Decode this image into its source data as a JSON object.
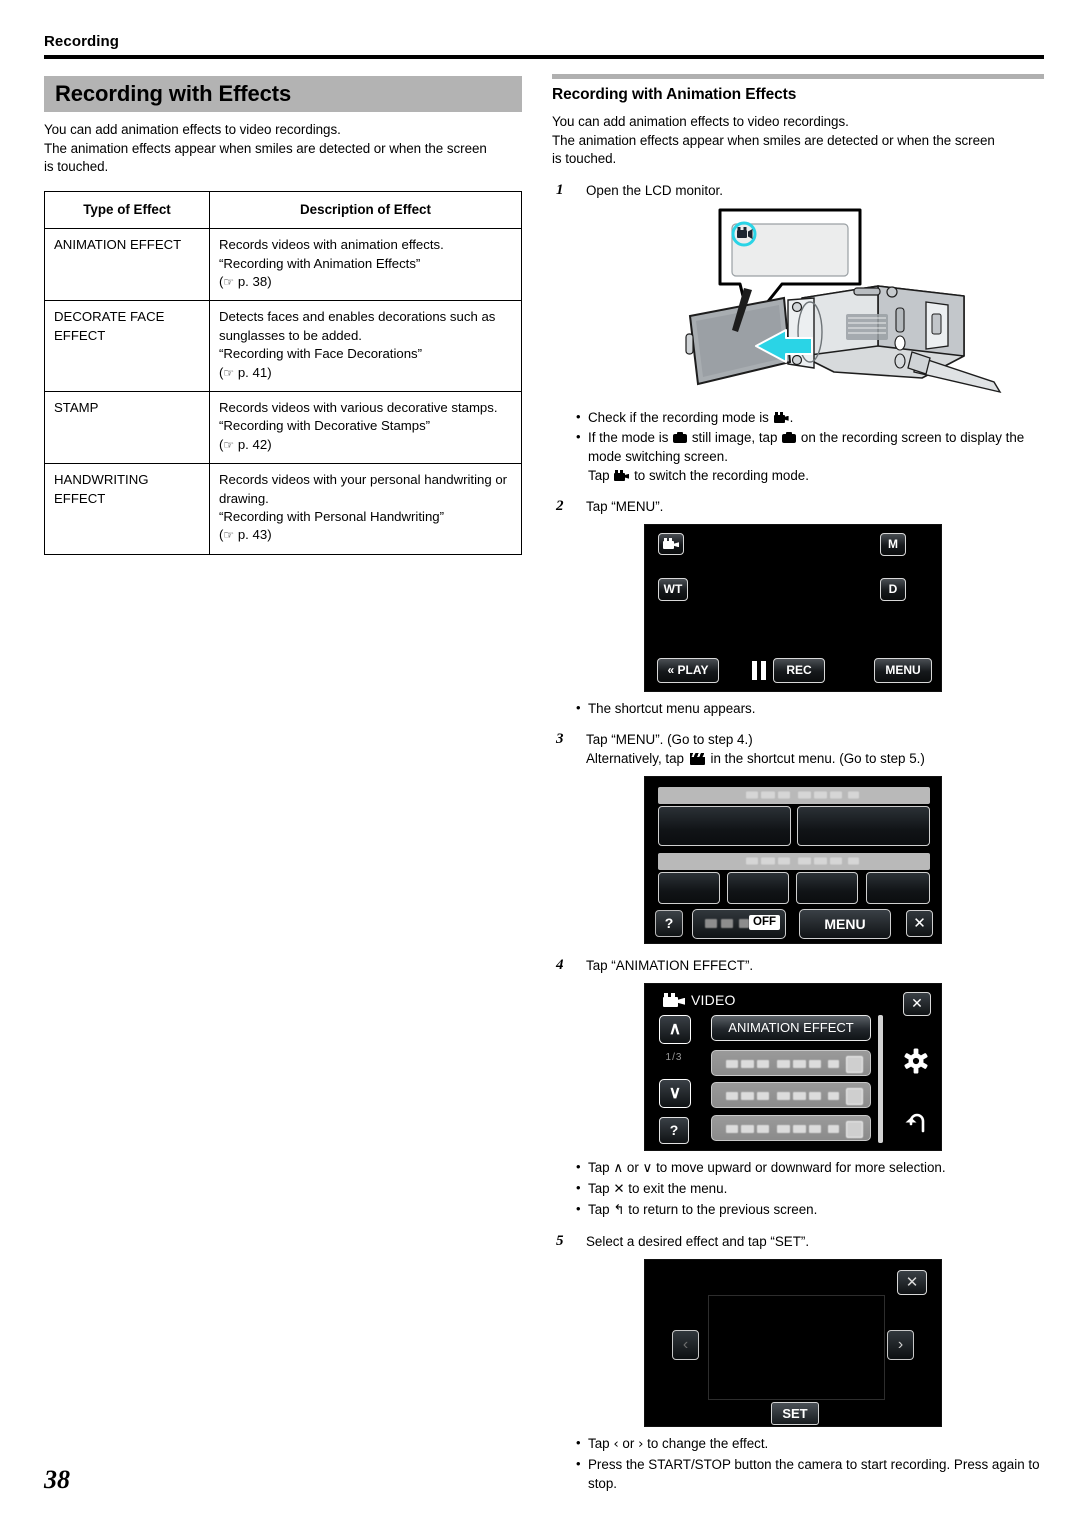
{
  "header": {
    "running_head": "Recording"
  },
  "left_column": {
    "title": "Recording with Effects",
    "intro_line1": "You can add animation effects to video recordings.",
    "intro_line2": "The animation effects appear when smiles are detected or when the screen",
    "intro_line3": "is touched.",
    "table": {
      "headers": [
        "Type of Effect",
        "Description of Effect"
      ],
      "rows": [
        {
          "type": "ANIMATION EFFECT",
          "desc_line1": "Records videos with animation effects.",
          "desc_line2": "“Recording with Animation Effects”",
          "page_ref": "p. 38"
        },
        {
          "type": "DECORATE FACE EFFECT",
          "desc_line1": "Detects faces and enables decorations such as sunglasses to be added.",
          "desc_line2": "“Recording with Face Decorations”",
          "page_ref": "p. 41"
        },
        {
          "type": "STAMP",
          "desc_line1": "Records videos with various decorative stamps.",
          "desc_line2": "“Recording with Decorative Stamps”",
          "page_ref": "p. 42"
        },
        {
          "type": "HANDWRITING EFFECT",
          "desc_line1": "Records videos with your personal handwriting or drawing.",
          "desc_line2": "“Recording with Personal Handwriting”",
          "page_ref": "p. 43"
        }
      ]
    }
  },
  "right_column": {
    "section_title": "Recording with Animation Effects",
    "intro_line1": "You can add animation effects to video recordings.",
    "intro_line2": "The animation effects appear when smiles are detected or when the screen",
    "intro_line3": "is touched.",
    "steps": [
      {
        "num": "1",
        "text": "Open the LCD monitor."
      },
      {
        "num": "2",
        "text": "Tap “MENU”."
      },
      {
        "num": "3",
        "line1": "Tap “MENU”. (Go to step 4.)",
        "line2_a": "Alternatively, tap",
        "line2_b": "in the shortcut menu. (Go to step 5.)"
      },
      {
        "num": "4",
        "text": "Tap “ANIMATION EFFECT”."
      },
      {
        "num": "5",
        "text": "Select a desired effect and tap “SET”."
      }
    ],
    "bullets_step1": [
      {
        "a": "Check if the recording mode is",
        "b": "."
      },
      {
        "a": "If the mode is",
        "b": "still image, tap",
        "c": "on the recording screen to display the mode switching screen.",
        "d": "Tap",
        "e": "to switch the recording mode."
      }
    ],
    "bullet_step2": "The shortcut menu appears.",
    "bullets_step4": [
      {
        "a": "Tap",
        "sym1": "∧",
        "mid": "or",
        "sym2": "∨",
        "b": "to move upward or downward for more selection."
      },
      {
        "a": "Tap",
        "sym1": "✕",
        "b": "to exit the menu."
      },
      {
        "a": "Tap",
        "sym1": "↰",
        "b": "to return to the previous screen."
      }
    ],
    "bullets_step5": [
      {
        "a": "Tap",
        "sym1": "‹",
        "mid": "or",
        "sym2": "›",
        "b": "to change the effect."
      },
      {
        "a": "Press the START/STOP button the camera to start recording. Press again to stop."
      }
    ]
  },
  "screens": {
    "recording_screen": {
      "mode_icon": "video-mode-icon",
      "m_button": "M",
      "d_button": "D",
      "wt_button": "WT",
      "play_button": "« PLAY",
      "rec_button": "REC",
      "menu_button": "MENU"
    },
    "shortcut_menu": {
      "help_button": "?",
      "off_badge": "OFF",
      "menu_button": "MENU",
      "close_button": "✕"
    },
    "video_menu": {
      "title": "VIDEO",
      "selected_item": "ANIMATION EFFECT",
      "close_button": "✕",
      "up_button": "∧",
      "down_button": "∨",
      "page_indicator": "1/3",
      "help_button": "?",
      "gear_button": "gear-icon",
      "back_button": "back-arrow-icon"
    },
    "effect_preview": {
      "close_button": "✕",
      "prev_button": "‹",
      "next_button": "›",
      "set_button": "SET"
    }
  },
  "footer": {
    "page_number": "38"
  },
  "colors": {
    "title_band": "#b3b3b3",
    "section_rule": "#b0b0b0",
    "screen_bg": "#000000",
    "highlight_cyan": "#2ad4e6"
  }
}
